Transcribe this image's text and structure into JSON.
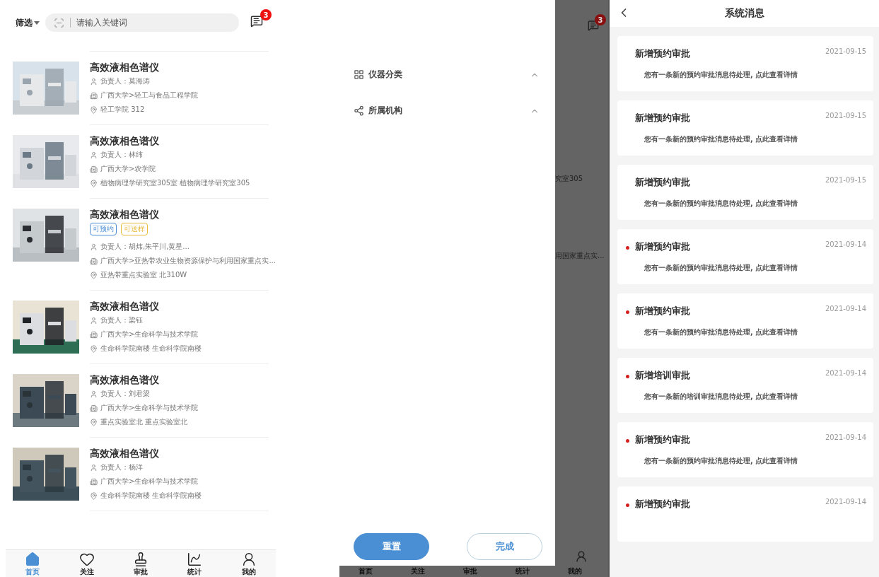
{
  "home": {
    "filter": {
      "label": "筛选"
    },
    "search": {
      "placeholder": "请输入关键词"
    },
    "badge": "3",
    "items": [
      {
        "title": "高效液相色谱仪",
        "manager": "负责人：莫海涛",
        "org": "广西大学>轻工与食品工程学院",
        "location": "轻工学院 312"
      },
      {
        "title": "高效液相色谱仪",
        "manager": "负责人：林纬",
        "org": "广西大学>农学院",
        "location": "植物病理学研究室305室 植物病理学研究室305"
      },
      {
        "title": "高效液相色谱仪",
        "tags": [
          {
            "label": "可预约",
            "color": "#4a8fd4"
          },
          {
            "label": "可送样",
            "color": "#e8b93a"
          }
        ],
        "manager": "负责人：胡炜,朱平川,黄星...",
        "org": "广西大学>亚热带农业生物资源保护与利用国家重点实...",
        "location": "亚热带重点实验室 北310W"
      },
      {
        "title": "高效液相色谱仪",
        "manager": "负责人：梁钰",
        "org": "广西大学>生命科学与技术学院",
        "location": "生命科学院南楼 生命科学院南楼"
      },
      {
        "title": "高效液相色谱仪",
        "manager": "负责人：刘君梁",
        "org": "广西大学>生命科学与技术学院",
        "location": "重点实验室北 重点实验室北"
      },
      {
        "title": "高效液相色谱仪",
        "manager": "负责人：杨洋",
        "org": "广西大学>生命科学与技术学院",
        "location": "生命科学院南楼 生命科学院南楼"
      }
    ],
    "nav": [
      {
        "label": "首页",
        "selected": true
      },
      {
        "label": "关注",
        "selected": false
      },
      {
        "label": "审批",
        "selected": false
      },
      {
        "label": "统计",
        "selected": false
      },
      {
        "label": "我的",
        "selected": false
      }
    ]
  },
  "filter_drawer": {
    "sections": [
      {
        "label": "仪器分类",
        "expanded": false
      },
      {
        "label": "所属机构",
        "expanded": false
      }
    ],
    "buttons": [
      {
        "label": "重置",
        "kind": "primary"
      },
      {
        "label": "完成",
        "kind": "secondary"
      }
    ],
    "behind": {
      "badge": "3",
      "fragments": [
        "究室305",
        "用国家重点实..."
      ],
      "nav": [
        {
          "label": "首页"
        },
        {
          "label": "关注"
        },
        {
          "label": "审批"
        },
        {
          "label": "统计"
        },
        {
          "label": "我的"
        }
      ]
    }
  },
  "system_messages": {
    "title": "系统消息",
    "messages": [
      {
        "title": "新增预约审批",
        "date": "2021-09-15",
        "body": "您有一条新的预约审批消息待处理, 点此查看详情",
        "unread": false
      },
      {
        "title": "新增预约审批",
        "date": "2021-09-15",
        "body": "您有一条新的预约审批消息待处理, 点此查看详情",
        "unread": false
      },
      {
        "title": "新增预约审批",
        "date": "2021-09-15",
        "body": "您有一条新的预约审批消息待处理, 点此查看详情",
        "unread": false
      },
      {
        "title": "新增预约审批",
        "date": "2021-09-14",
        "body": "您有一条新的预约审批消息待处理, 点此查看详情",
        "unread": true
      },
      {
        "title": "新增预约审批",
        "date": "2021-09-14",
        "body": "您有一条新的预约审批消息待处理, 点此查看详情",
        "unread": true
      },
      {
        "title": "新增培训审批",
        "date": "2021-09-14",
        "body": "您有一条新的培训审批消息待处理, 点此查看详情",
        "unread": true
      },
      {
        "title": "新增预约审批",
        "date": "2021-09-14",
        "body": "您有一条新的预约审批消息待处理, 点此查看详情",
        "unread": true
      },
      {
        "title": "新增预约审批",
        "date": "2021-09-14",
        "unread": true
      }
    ]
  }
}
